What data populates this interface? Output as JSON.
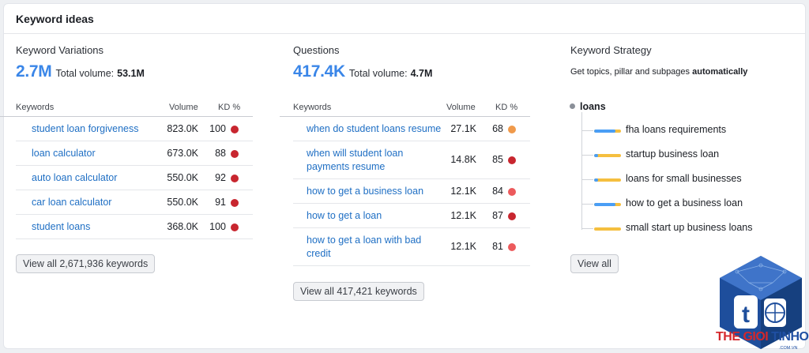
{
  "header": {
    "title": "Keyword ideas"
  },
  "variations": {
    "title": "Keyword Variations",
    "count": "2.7M",
    "volume_label": "Total volume:",
    "volume_value": "53.1M",
    "columns": [
      "Keywords",
      "Volume",
      "KD %"
    ],
    "rows": [
      {
        "keyword": "student loan forgiveness",
        "volume": "823.0K",
        "kd": "100",
        "kd_color": "#c8262f"
      },
      {
        "keyword": "loan calculator",
        "volume": "673.0K",
        "kd": "88",
        "kd_color": "#c8262f"
      },
      {
        "keyword": "auto loan calculator",
        "volume": "550.0K",
        "kd": "92",
        "kd_color": "#c8262f"
      },
      {
        "keyword": "car loan calculator",
        "volume": "550.0K",
        "kd": "91",
        "kd_color": "#c8262f"
      },
      {
        "keyword": "student loans",
        "volume": "368.0K",
        "kd": "100",
        "kd_color": "#c8262f"
      }
    ],
    "button": "View all 2,671,936 keywords"
  },
  "questions": {
    "title": "Questions",
    "count": "417.4K",
    "volume_label": "Total volume:",
    "volume_value": "4.7M",
    "columns": [
      "Keywords",
      "Volume",
      "KD %"
    ],
    "rows": [
      {
        "keyword": "when do student loans resume",
        "volume": "27.1K",
        "kd": "68",
        "kd_color": "#f09a4b"
      },
      {
        "keyword": "when will student loan payments resume",
        "line1": "when will student loan",
        "line2": "payments resume",
        "volume": "14.8K",
        "kd": "85",
        "kd_color": "#c8262f"
      },
      {
        "keyword": "how to get a business loan",
        "volume": "12.1K",
        "kd": "84",
        "kd_color": "#ec5a5c"
      },
      {
        "keyword": "how to get a loan",
        "volume": "12.1K",
        "kd": "87",
        "kd_color": "#c8262f"
      },
      {
        "keyword": "how to get a loan with bad credit",
        "line1": "how to get a loan with bad",
        "line2": "credit",
        "volume": "12.1K",
        "kd": "81",
        "kd_color": "#ec5a5c"
      }
    ],
    "button": "View all 417,421 keywords"
  },
  "strategy": {
    "title": "Keyword Strategy",
    "subtitle_prefix": "Get topics, pillar and subpages",
    "subtitle_bold": "automatically",
    "root": "loans",
    "leaves": [
      {
        "label": "fha loans requirements",
        "blue_share": 0.8
      },
      {
        "label": "startup business loan",
        "blue_share": 0.15
      },
      {
        "label": "loans for small businesses",
        "blue_share": 0.15
      },
      {
        "label": "how to get a business loan",
        "blue_share": 0.8
      },
      {
        "label": "small start up business loans",
        "blue_share": 0.0
      }
    ],
    "button": "View all"
  },
  "watermark": {
    "brand_red": "THE GIOI ",
    "brand_blue": "TINHOC",
    "domain": ".COM.VN"
  }
}
